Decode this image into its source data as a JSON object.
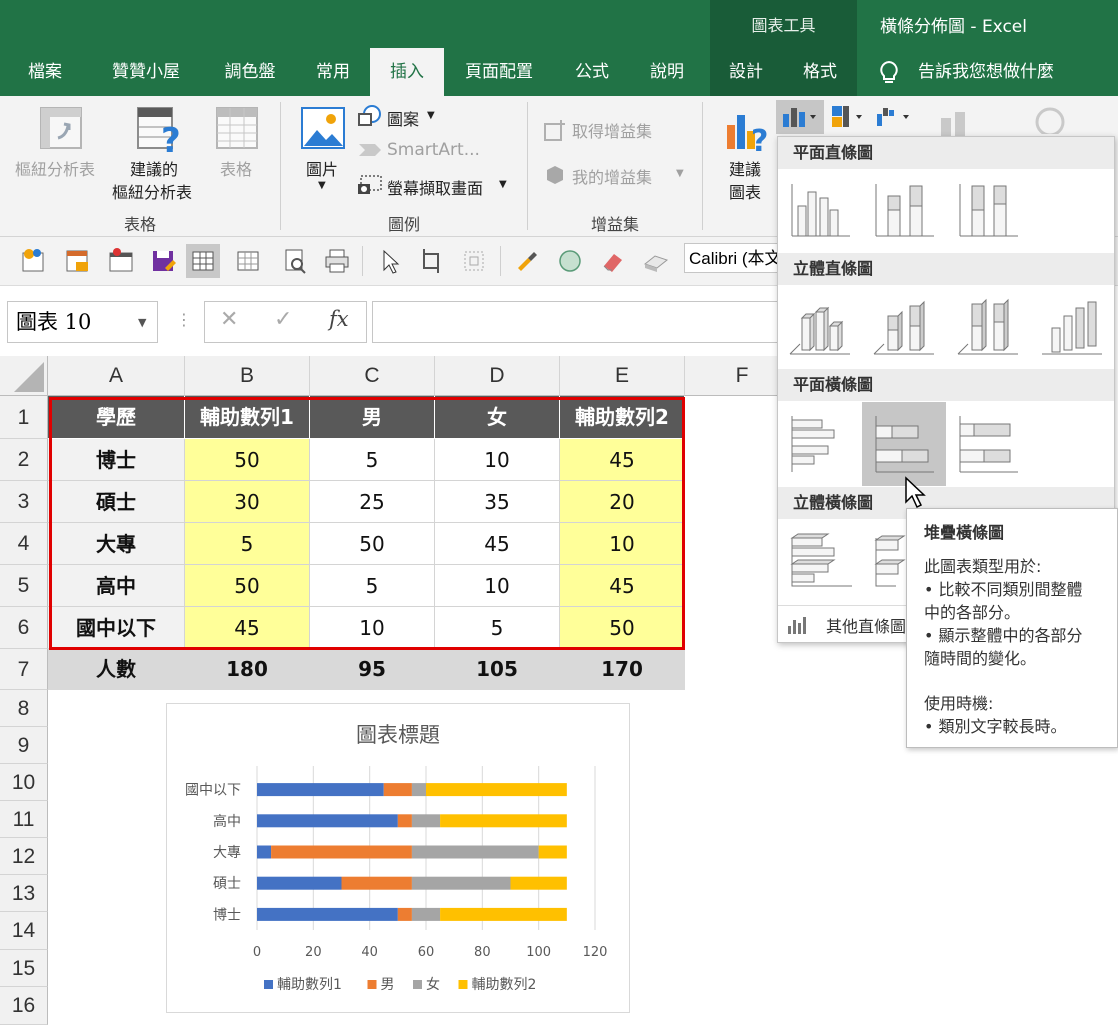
{
  "app": {
    "context_tab_group": "圖表工具",
    "window_title": "橫條分佈圖  -  Excel",
    "tabs": [
      "檔案",
      "贊贊小屋",
      "調色盤",
      "常用",
      "插入",
      "頁面配置",
      "公式",
      "說明",
      "設計",
      "格式"
    ],
    "active_tab": "插入",
    "tell_me": "告訴我您想做什麼"
  },
  "ribbon": {
    "pivot_table": "樞紐分析表",
    "recommended_pivot_line1": "建議的",
    "recommended_pivot_line2": "樞紐分析表",
    "table": "表格",
    "group_tables": "表格",
    "pictures": "圖片",
    "shapes": "圖案",
    "smartart": "SmartArt...",
    "screenshot": "螢幕擷取畫面",
    "group_illustrations": "圖例",
    "get_addins": "取得增益集",
    "my_addins": "我的增益集",
    "group_addins": "增益集",
    "recommended_charts_line1": "建議",
    "recommended_charts_line2": "圖表"
  },
  "toolbar": {
    "font_name": "Calibri (本文"
  },
  "formula_bar": {
    "name_box": "圖表 10",
    "fx": "fx",
    "cancel": "✕",
    "enter": "✓",
    "value": ""
  },
  "sheet": {
    "columns": [
      "A",
      "B",
      "C",
      "D",
      "E",
      "F"
    ],
    "rows": [
      "1",
      "2",
      "3",
      "4",
      "5",
      "6",
      "7",
      "8",
      "9",
      "10",
      "11",
      "12",
      "13",
      "14",
      "15",
      "16"
    ],
    "header": [
      "學歷",
      "輔助數列1",
      "男",
      "女",
      "輔助數列2"
    ],
    "data": [
      [
        "博士",
        "50",
        "5",
        "10",
        "45"
      ],
      [
        "碩士",
        "30",
        "25",
        "35",
        "20"
      ],
      [
        "大專",
        "5",
        "50",
        "45",
        "10"
      ],
      [
        "高中",
        "50",
        "5",
        "10",
        "45"
      ],
      [
        "國中以下",
        "45",
        "10",
        "5",
        "50"
      ]
    ],
    "total": [
      "人數",
      "180",
      "95",
      "105",
      "170"
    ]
  },
  "gallery": {
    "section_2d_column": "平面直條圖",
    "section_3d_column": "立體直條圖",
    "section_2d_bar": "平面橫條圖",
    "section_3d_bar": "立體橫條圖",
    "more": "其他直條圖..."
  },
  "tooltip": {
    "title": "堆疊橫條圖",
    "lines": [
      "此圖表類型用於:",
      "• 比較不同類別間整體",
      "中的各部分。",
      "• 顯示整體中的各部分",
      "隨時間的變化。"
    ],
    "lines2": [
      "使用時機:",
      "• 類別文字較長時。"
    ]
  },
  "chart_data": {
    "type": "bar",
    "stacked": true,
    "orientation": "horizontal",
    "title": "圖表標題",
    "categories": [
      "博士",
      "碩士",
      "大專",
      "高中",
      "國中以下"
    ],
    "series": [
      {
        "name": "輔助數列1",
        "color": "#4472c4",
        "values": [
          50,
          30,
          5,
          50,
          45
        ]
      },
      {
        "name": "男",
        "color": "#ed7d31",
        "values": [
          5,
          25,
          50,
          5,
          10
        ]
      },
      {
        "name": "女",
        "color": "#a5a5a5",
        "values": [
          10,
          35,
          45,
          10,
          5
        ]
      },
      {
        "name": "輔助數列2",
        "color": "#ffc000",
        "values": [
          45,
          20,
          10,
          45,
          50
        ]
      }
    ],
    "xlim": [
      0,
      120
    ],
    "xticks": [
      "0",
      "20",
      "40",
      "60",
      "80",
      "100",
      "120"
    ],
    "grid": true,
    "legend": "bottom"
  }
}
